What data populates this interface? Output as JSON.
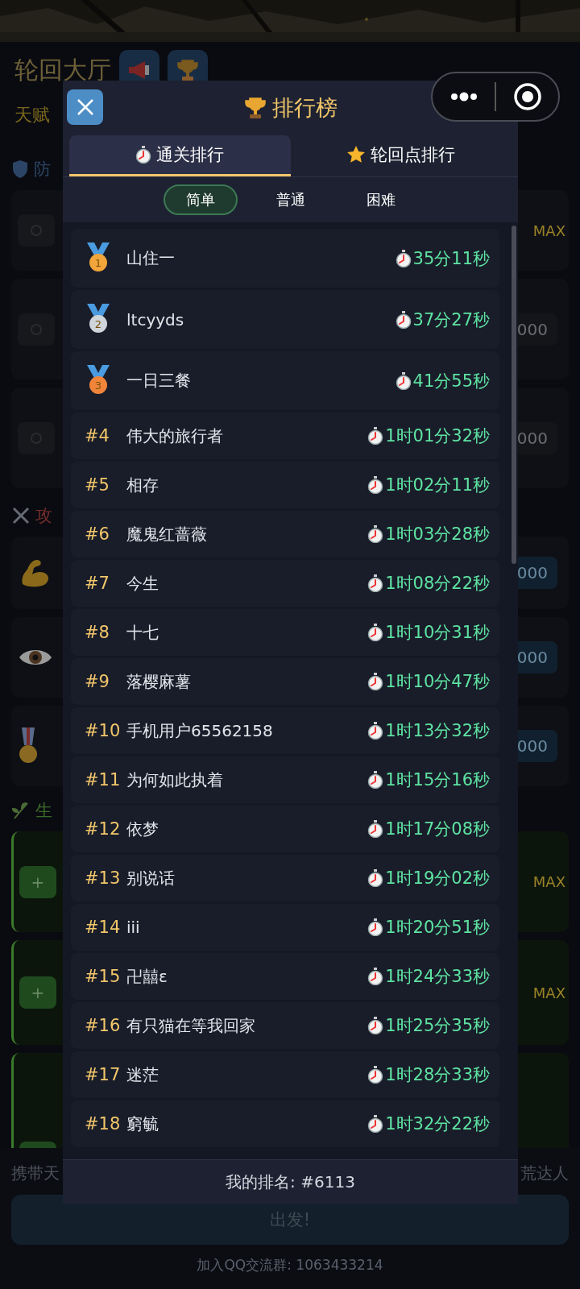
{
  "background": {
    "title": "轮回大厅",
    "header_buttons": [
      {
        "kind": "megaphone"
      },
      {
        "kind": "trophy"
      }
    ],
    "talent_label": "天赋",
    "sections": [
      {
        "kind": "defense",
        "heading": "防",
        "cards": [
          {
            "kind": "maxed",
            "value": "MAX"
          },
          {
            "kind": "plain",
            "value": "000"
          },
          {
            "kind": "plain",
            "value": "000"
          }
        ]
      },
      {
        "kind": "attack",
        "heading": "攻",
        "cards": [
          {
            "kind": "muscle",
            "value": "000"
          },
          {
            "kind": "eye",
            "value": "000"
          },
          {
            "kind": "medal",
            "value": "000"
          }
        ]
      },
      {
        "kind": "life",
        "heading": "生",
        "cards": [
          {
            "kind": "plus",
            "button": "+",
            "value": "MAX"
          },
          {
            "kind": "plus",
            "button": "+",
            "value": "MAX"
          },
          {
            "kind": "plus"
          }
        ]
      }
    ],
    "carry_left": "携带天",
    "carry_right": "荒达人",
    "go_button": "出发!",
    "footer": "加入QQ交流群: 1063433214"
  },
  "dialog": {
    "title": "排行榜",
    "tabs": [
      {
        "label": "通关排行",
        "kind": "stopwatch",
        "selected": true
      },
      {
        "label": "轮回点排行",
        "kind": "star",
        "selected": false
      }
    ],
    "difficulties": [
      {
        "label": "简单",
        "selected": true
      },
      {
        "label": "普通",
        "selected": false
      },
      {
        "label": "困难",
        "selected": false
      }
    ],
    "rows": [
      {
        "kind": "medal",
        "rank": "1",
        "color": "#f2a53a",
        "name": "山住一",
        "time": "35分11秒"
      },
      {
        "kind": "medal",
        "rank": "2",
        "color": "#cfd5da",
        "name": "ltcyyds",
        "time": "37分27秒"
      },
      {
        "kind": "medal",
        "rank": "3",
        "color": "#f0853a",
        "name": "一日三餐",
        "time": "41分55秒"
      },
      {
        "kind": "number",
        "rank": "#4",
        "name": "伟大的旅行者",
        "time": "1时01分32秒"
      },
      {
        "kind": "number",
        "rank": "#5",
        "name": "相存",
        "time": "1时02分11秒"
      },
      {
        "kind": "number",
        "rank": "#6",
        "name": "魔鬼红蔷薇",
        "time": "1时03分28秒"
      },
      {
        "kind": "number",
        "rank": "#7",
        "name": "今生",
        "time": "1时08分22秒"
      },
      {
        "kind": "number",
        "rank": "#8",
        "name": "十七",
        "time": "1时10分31秒"
      },
      {
        "kind": "number",
        "rank": "#9",
        "name": "落樱麻薯",
        "time": "1时10分47秒"
      },
      {
        "kind": "number",
        "rank": "#10",
        "name": "手机用户65562158",
        "time": "1时13分32秒"
      },
      {
        "kind": "number",
        "rank": "#11",
        "name": "为何如此执着",
        "time": "1时15分16秒"
      },
      {
        "kind": "number",
        "rank": "#12",
        "name": "依梦",
        "time": "1时17分08秒"
      },
      {
        "kind": "number",
        "rank": "#13",
        "name": "别说话",
        "time": "1时19分02秒"
      },
      {
        "kind": "number",
        "rank": "#14",
        "name": "iii",
        "time": "1时20分51秒"
      },
      {
        "kind": "number",
        "rank": "#15",
        "name": "卍囍ε",
        "time": "1时24分33秒"
      },
      {
        "kind": "number",
        "rank": "#16",
        "name": "有只猫在等我回家",
        "time": "1时25分35秒"
      },
      {
        "kind": "number",
        "rank": "#17",
        "name": "迷茫",
        "time": "1时28分33秒"
      },
      {
        "kind": "number",
        "rank": "#18",
        "name": "窮毓",
        "time": "1时32分22秒"
      }
    ],
    "my_rank": "我的排名: #6113"
  }
}
